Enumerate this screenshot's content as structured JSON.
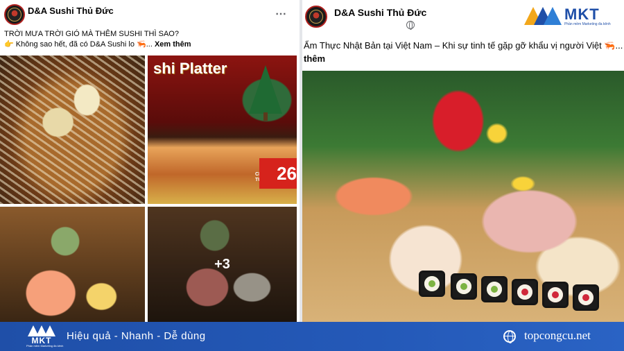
{
  "left_post": {
    "page_name": "D&A Sushi Thủ Đức",
    "more_icon": "⋯",
    "text_line1": "TRỜI MƯA TRỜI GIÓ MÀ THÊM SUSHI THÌ SAO?",
    "text_line2_prefix": "👉 Không sao hết, đã có D&A Sushi lo 🦐...",
    "see_more": "Xem thêm",
    "photos": {
      "platter_title": "shi Platter",
      "price_prefix": "CHỈ\nTỪ",
      "price": "26",
      "more_count": "+3"
    }
  },
  "right_post": {
    "page_name": "D&A Sushi Thủ Đức",
    "text": "Ẩm Thực Nhật Bản tại Việt Nam – Khi sự tinh tế gặp gỡ khẩu vị người Việt 🦐...",
    "see_more": "thêm"
  },
  "watermark": {
    "brand": "MKT",
    "tagline": "Phần mềm Marketing đa kênh"
  },
  "banner": {
    "logo_word": "MKT",
    "logo_tagline": "Phần mềm Marketing đa kênh",
    "slogan": "Hiệu quả - Nhanh - Dễ dùng",
    "website": "topcongcu.net",
    "accent_color": "#1f4fa8"
  },
  "icons": [
    "avatar-icon",
    "more-options-icon",
    "globe-icon",
    "christmas-tree-icon",
    "globe-web-icon"
  ]
}
